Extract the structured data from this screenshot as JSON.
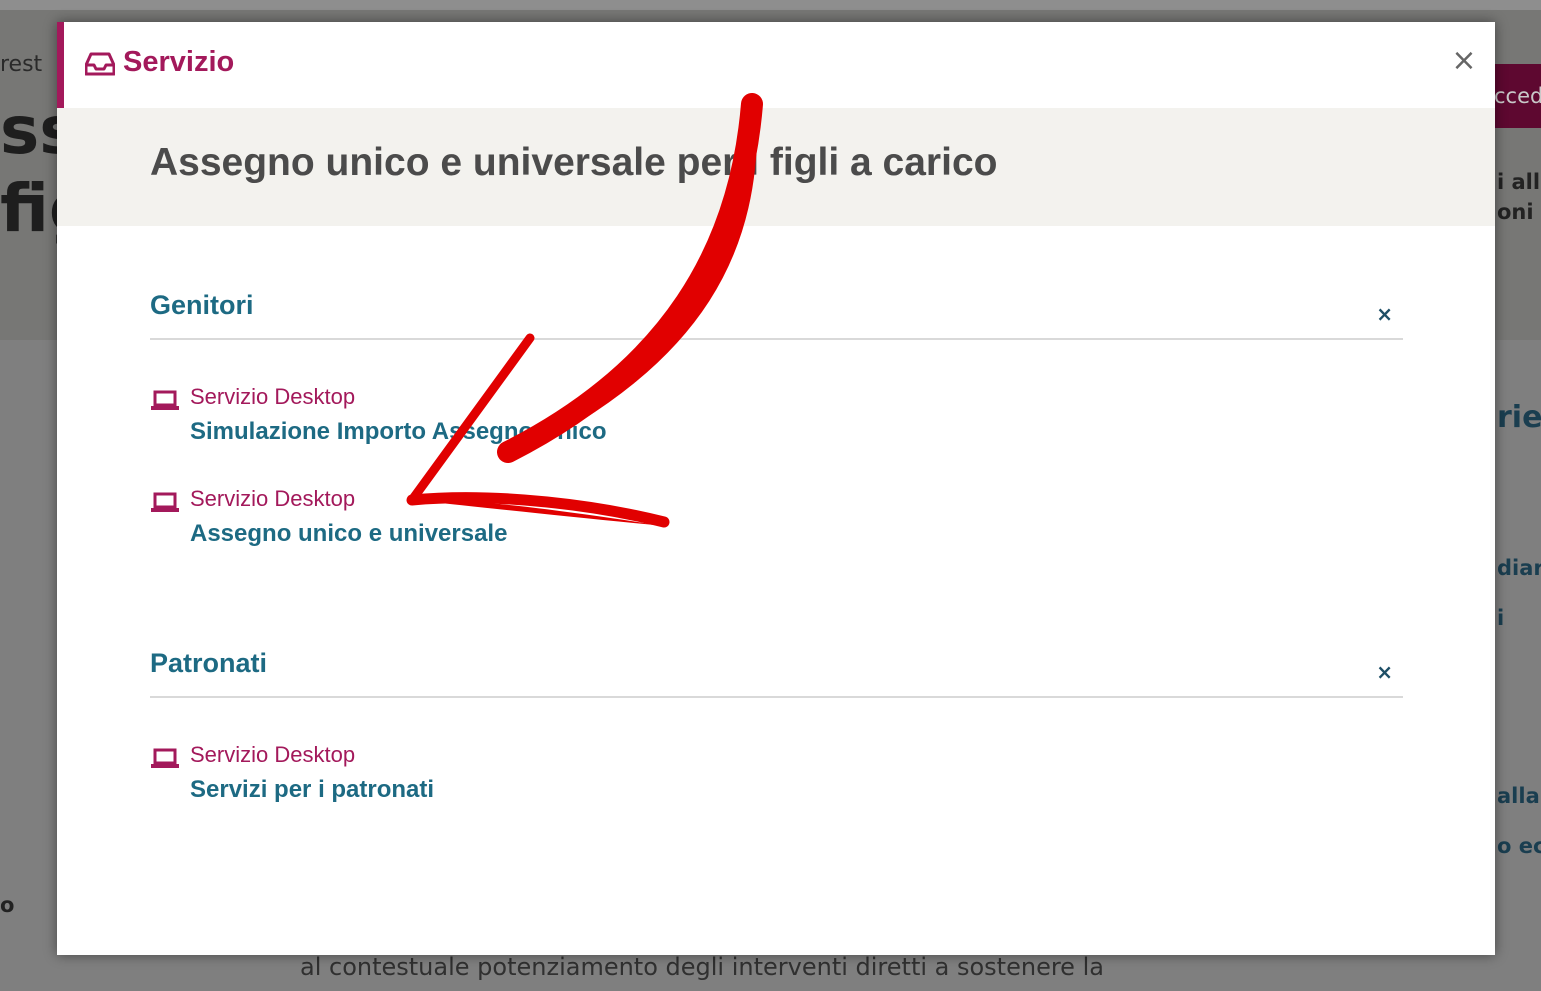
{
  "background": {
    "breadcrumb_fragment": "rest",
    "heading_fragment_1": "ss",
    "heading_fragment_2": "fig",
    "button_fragment": "cced",
    "right_fragments": [
      "i all",
      "oni",
      "rie",
      "diari",
      "i",
      "alla",
      "o ec"
    ],
    "left_fragment": "o",
    "bottom_text": "al contestuale potenziamento degli interventi diretti a sostenere la"
  },
  "modal": {
    "header_icon": "inbox-icon",
    "header_title": "Servizio",
    "close_label": "×",
    "banner_title": "Assegno unico e universale per i figli a carico",
    "sections": [
      {
        "title": "Genitori",
        "toggle": "×",
        "services": [
          {
            "type": "Servizio Desktop",
            "icon": "laptop-icon",
            "label": "Simulazione Importo Assegno Unico"
          },
          {
            "type": "Servizio Desktop",
            "icon": "laptop-icon",
            "label": "Assegno unico e universale"
          }
        ]
      },
      {
        "title": "Patronati",
        "toggle": "×",
        "services": [
          {
            "type": "Servizio Desktop",
            "icon": "laptop-icon",
            "label": "Servizi per i patronati"
          }
        ]
      }
    ]
  },
  "annotation": {
    "type": "arrow-icon",
    "color": "#e10000",
    "target": "Assegno unico e universale"
  },
  "colors": {
    "accent": "#a3195b",
    "link": "#1d6a83",
    "banner_bg": "#f3f2ee"
  }
}
